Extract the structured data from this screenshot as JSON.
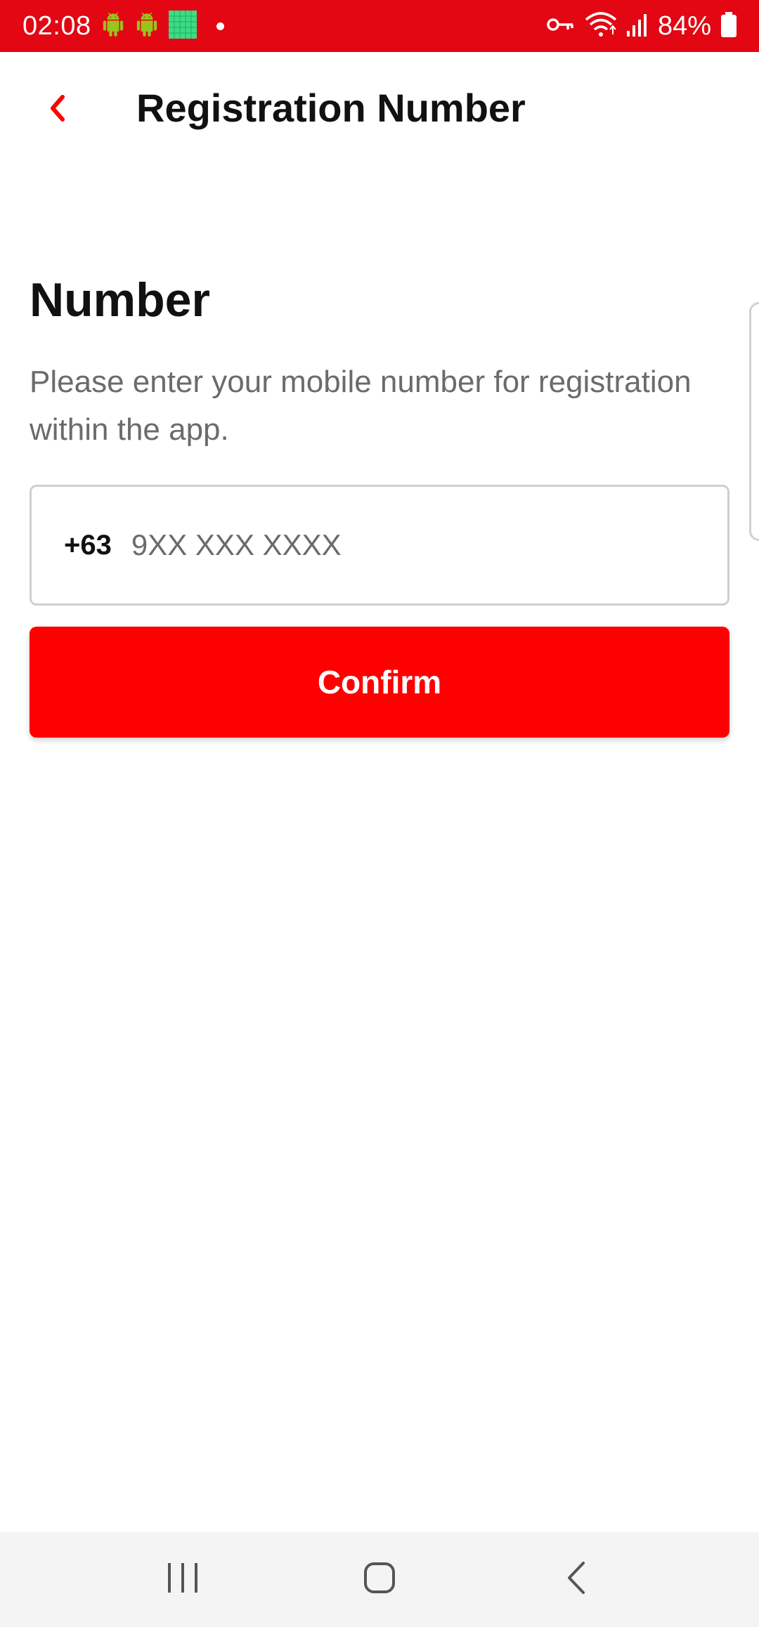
{
  "status_bar": {
    "time": "02:08",
    "battery_percent": "84%",
    "background_color": "#e30613",
    "left_icons": [
      "android-icon",
      "android-icon",
      "app-grid-icon",
      "notification-dot-icon"
    ],
    "right_icons": [
      "vpn-key-icon",
      "wifi-icon",
      "signal-icon",
      "battery-icon"
    ]
  },
  "app_bar": {
    "back_icon": "chevron-left-icon",
    "title": "Registration Number"
  },
  "main": {
    "heading": "Number",
    "description": "Please enter your mobile number for registration within the app.",
    "phone_field": {
      "country_code": "+63",
      "value": "",
      "placeholder": "9XX XXX XXXX"
    },
    "confirm_label": "Confirm",
    "accent_color": "#ff0000"
  },
  "nav_bar": {
    "items": [
      "recent-apps-icon",
      "home-icon",
      "back-icon"
    ]
  }
}
